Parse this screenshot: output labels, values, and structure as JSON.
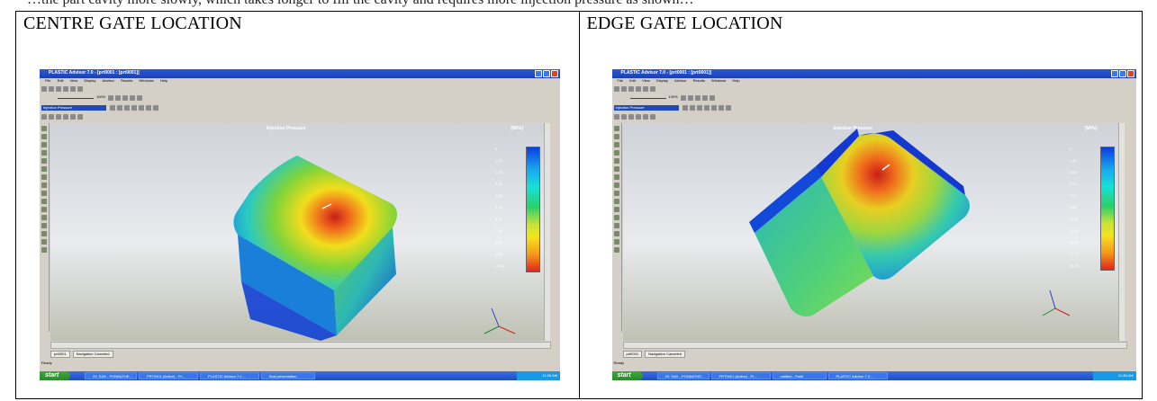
{
  "top_caption": "…the part cavity more slowly, which takes longer to fill the cavity and requires more injection pressure as shown…",
  "cells": [
    {
      "heading": "CENTRE GATE LOCATION",
      "app": {
        "window_title": "PLASTIC Advisor 7.0 - [prt0001 : [prt0001]]",
        "menu": [
          "File",
          "Edit",
          "View",
          "Display",
          "Advisor",
          "Results",
          "Windows",
          "Help"
        ],
        "zoom": "100%",
        "result_select": "Injection Pressure",
        "plot_title": "Injection Pressure",
        "unit": "[MPa]",
        "legend_values": [
          "0",
          "1.07",
          "2.13",
          "3.20",
          "4.26",
          "5.33",
          "6.39",
          "7.46",
          "8.52",
          "9.59",
          "10.66"
        ],
        "tab_model": "prt0001",
        "tab_status": "Navigation Canceled",
        "status": "Ready",
        "taskbar": {
          "start": "start",
          "items": [
            "29. SAD - PONNATHE...",
            "PRT0001 (Active) - Pr...",
            "PLASTIC Advisor 7.0 ...",
            "final presentation"
          ],
          "clock": "11:35 AM"
        }
      }
    },
    {
      "heading": "EDGE GATE LOCATION",
      "app": {
        "window_title": "PLASTIC Advisor 7.0 - [prt0001 : [prt0001]]",
        "menu": [
          "File",
          "Edit",
          "View",
          "Display",
          "Advisor",
          "Results",
          "Windows",
          "Help"
        ],
        "zoom": "100%",
        "result_select": "Injection Pressure",
        "plot_title": "Injection Pressure",
        "unit": "[MPa]",
        "legend_values": [
          "0",
          "1.93",
          "3.86",
          "5.79",
          "7.72",
          "9.65",
          "11.58",
          "13.51",
          "15.44",
          "17.37",
          "19.30"
        ],
        "tab_model": "prt0001",
        "tab_status": "Navigation Canceled",
        "status": "Ready",
        "taskbar": {
          "start": "start",
          "items": [
            "29. SAD - PONNATHE...",
            "PRT0001 (Active) - Pr...",
            "untitled - Paint",
            "PLASTIC Advisor 7.0 ..."
          ],
          "clock": "11:38 AM"
        }
      }
    }
  ],
  "colors": {
    "xp_blue": "#1f4dc4",
    "start_green": "#2b8a2a",
    "gradient_low": "#0a3de0",
    "gradient_high": "#e0241a"
  }
}
